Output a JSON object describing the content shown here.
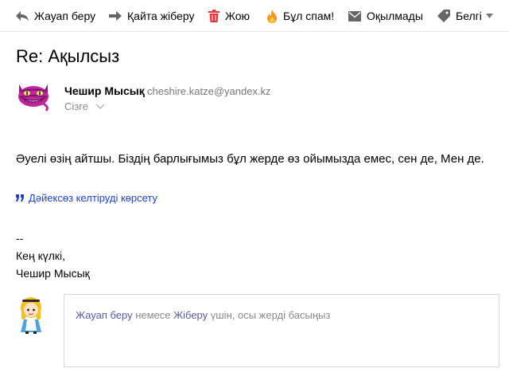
{
  "toolbar": {
    "reply": "Жауап беру",
    "forward": "Қайта жіберу",
    "delete": "Жою",
    "spam": "Бұл спам!",
    "unread": "Оқылмады",
    "label": "Белгі"
  },
  "message": {
    "subject": "Re: Ақылсыз",
    "sender_name": "Чешир Мысық",
    "sender_email": "cheshire.katze@yandex.kz",
    "recipient": "Сізге",
    "body": "Әуелі өзің айтшы. Біздің барлығымыз бұл жерде өз ойымызда емес, сен де, Мен де.",
    "show_quote": "Дәйексөз келтіруді көрсету",
    "signature": {
      "dashes": "--",
      "line1": "Кең күлкі,",
      "line2": "Чешир Мысық"
    }
  },
  "reply_box": {
    "reply_link": "Жауап беру",
    "or": " немесе ",
    "forward_link": "Жіберу",
    "rest": " үшін, осы жерді басыңыз"
  },
  "colors": {
    "link": "#1e3fcc",
    "delete_icon": "#e8343a",
    "spam_icon": "#f7941d",
    "icon_gray": "#666666"
  }
}
